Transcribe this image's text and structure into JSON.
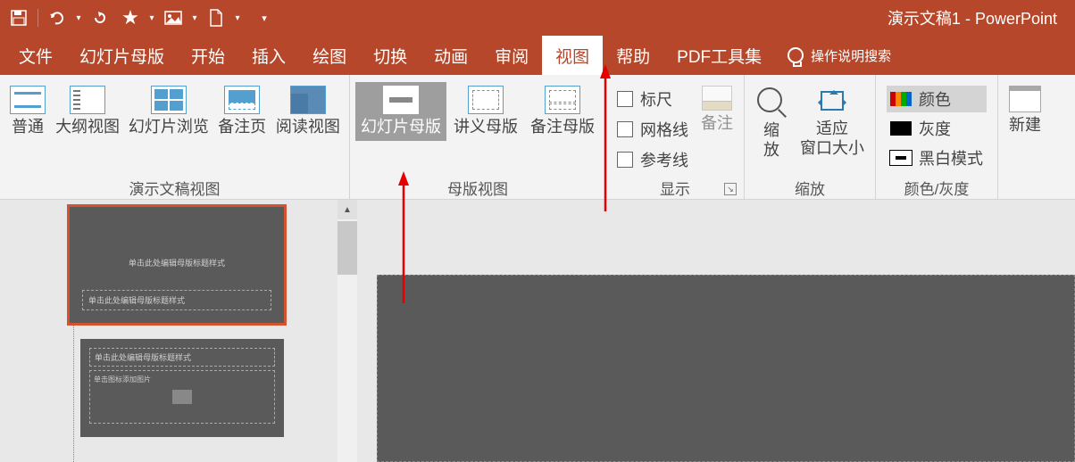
{
  "title": "演示文稿1  -  PowerPoint",
  "tabs": {
    "file": "文件",
    "slidemaster": "幻灯片母版",
    "home": "开始",
    "insert": "插入",
    "draw": "绘图",
    "transitions": "切换",
    "animations": "动画",
    "review": "审阅",
    "view": "视图",
    "help": "帮助",
    "pdf": "PDF工具集",
    "tellme": "操作说明搜索"
  },
  "ribbon": {
    "presentation_views": {
      "normal": "普通",
      "outline": "大纲视图",
      "sorter": "幻灯片浏览",
      "notes": "备注页",
      "reading": "阅读视图",
      "label": "演示文稿视图"
    },
    "master_views": {
      "slide": "幻灯片母版",
      "handout": "讲义母版",
      "notes": "备注母版",
      "label": "母版视图"
    },
    "show": {
      "ruler": "标尺",
      "gridlines": "网格线",
      "guides": "参考线",
      "notes_btn": "备注",
      "label": "显示"
    },
    "zoom": {
      "zoom": "缩\n放",
      "fit": "适应\n窗口大小",
      "label": "缩放"
    },
    "color": {
      "color": "颜色",
      "gray": "灰度",
      "bw": "黑白模式",
      "label": "颜色/灰度"
    },
    "window": {
      "new": "新建"
    }
  },
  "thumbnails": {
    "slide1": {
      "title_placeholder": "单击此处编辑母版标题样式",
      "subtitle_placeholder": "单击此处编辑母版标题样式"
    },
    "slide2": {
      "title_placeholder": "单击此处编辑母版标题样式",
      "body_placeholder": "单击图标添加图片"
    }
  }
}
